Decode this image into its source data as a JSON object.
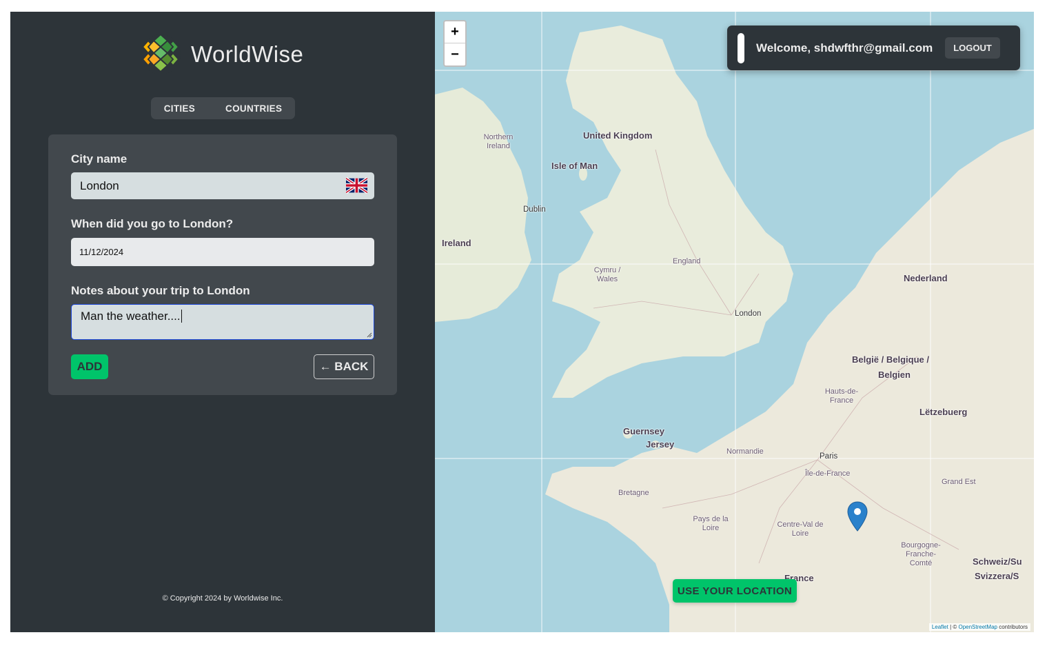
{
  "brand": {
    "name": "WorldWise"
  },
  "nav": {
    "cities": "CITIES",
    "countries": "COUNTRIES"
  },
  "form": {
    "city_label": "City name",
    "city_value": "London",
    "flag_icon": "uk-flag-icon",
    "date_label": "When did you go to London?",
    "date_value": "11/12/2024",
    "notes_label": "Notes about your trip to London",
    "notes_value": "Man the weather....",
    "add_label": "ADD",
    "back_label": "← BACK"
  },
  "footer": {
    "copyright": "© Copyright 2024 by Worldwise Inc."
  },
  "map": {
    "zoom_in": "+",
    "zoom_out": "−",
    "welcome": "Welcome, shdwfthr@gmail.com",
    "logout": "LOGOUT",
    "use_location": "USE YOUR LOCATION",
    "attribution_leaflet": "Leaflet",
    "attribution_sep": " | © ",
    "attribution_osm": "OpenStreetMap",
    "attribution_tail": " contributors",
    "labels": {
      "united_kingdom": "United Kingdom",
      "isle_of_man": "Isle of Man",
      "ireland": "Ireland",
      "northern_ireland": "Northern Ireland",
      "dublin": "Dublin",
      "london": "London",
      "england": "England",
      "cymru": "Cymru / Wales",
      "nederland": "Nederland",
      "belgie": "België / Belgique /",
      "belgien": "Belgien",
      "letzebuerg": "Lëtzebuerg",
      "guernsey": "Guernsey",
      "jersey": "Jersey",
      "paris": "Paris",
      "ile_de_france": "Île-de-France",
      "normandie": "Normandie",
      "bretagne": "Bretagne",
      "pays_de_la_loire": "Pays de la Loire",
      "centre_val_de_loire": "Centre-Val de Loire",
      "bourgogne": "Bourgogne-Franche-Comté",
      "france": "France",
      "schweiz": "Schweiz/Su",
      "svizzera": "Svizzera/S",
      "hauts_de_france": "Hauts-de-France",
      "grand_est": "Grand Est"
    }
  },
  "colors": {
    "sidebar": "#2d3439",
    "panel": "#42484d",
    "accent": "#00c46a",
    "water": "#aad3df",
    "land": "#f2efe9"
  }
}
